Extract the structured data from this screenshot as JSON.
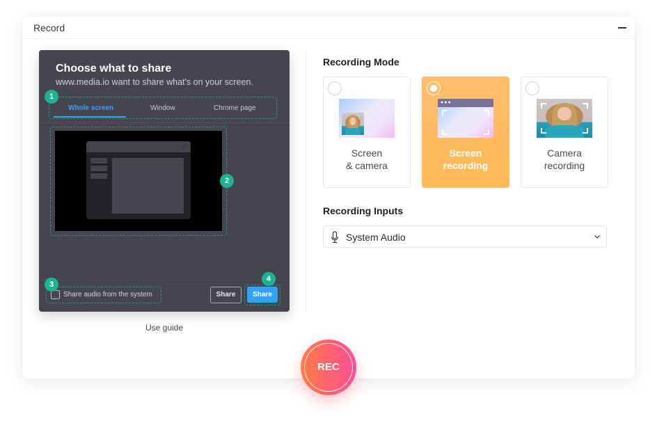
{
  "window": {
    "title": "Record",
    "minimize_icon": "minimize-icon"
  },
  "share_dialog": {
    "title": "Choose what to share",
    "subtitle": "www.media.io want to share what's on your screen.",
    "tabs": [
      {
        "label": "Whole screen",
        "active": true
      },
      {
        "label": "Window",
        "active": false
      },
      {
        "label": "Chrome page",
        "active": false
      }
    ],
    "audio_checkbox_label": "Share audio from the system",
    "audio_checked": false,
    "share_secondary_label": "Share",
    "share_primary_label": "Share",
    "steps": [
      "1",
      "2",
      "3",
      "4"
    ],
    "step_color": "#1bb394",
    "accent": "#2fa4f7"
  },
  "use_guide_label": "Use guide",
  "recording_mode": {
    "title": "Recording Mode",
    "options": [
      {
        "line1": "Screen",
        "line2": "& camera",
        "selected": false
      },
      {
        "line1": "Screen",
        "line2": "recording",
        "selected": true
      },
      {
        "line1": "Camera",
        "line2": "recording",
        "selected": false
      }
    ],
    "selected_color": "#ffbc6a"
  },
  "recording_inputs": {
    "title": "Recording Inputs",
    "selected": "System Audio",
    "icon": "microphone-icon"
  },
  "rec_button": {
    "label": "REC",
    "gradient": [
      "#ff7e45",
      "#fd4f9a"
    ]
  }
}
